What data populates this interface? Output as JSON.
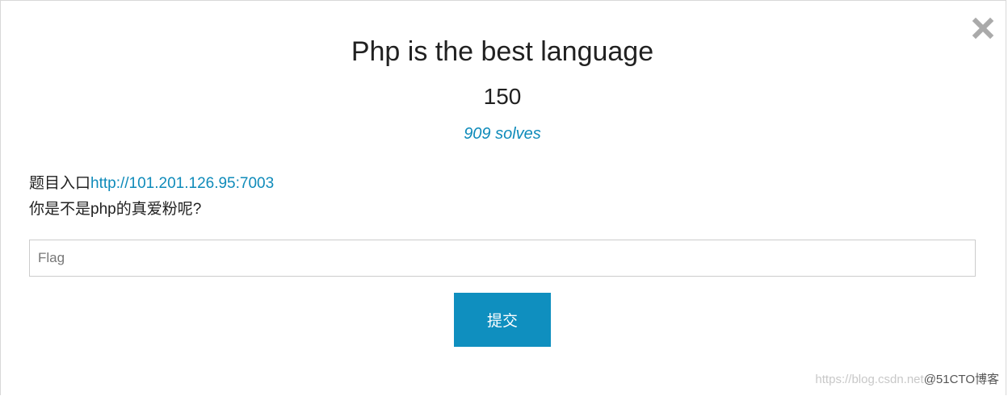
{
  "challenge": {
    "title": "Php is the best language",
    "points": "150",
    "solves": "909 solves",
    "description_prefix": "题目入口",
    "description_link": "http://101.201.126.95:7003",
    "description_line2": "你是不是php的真爱粉呢?"
  },
  "form": {
    "flag_placeholder": "Flag",
    "flag_value": "",
    "submit_label": "提交"
  },
  "close_icon": "close-x-icon",
  "watermark": {
    "url_text": "https://blog.csdn.net",
    "brand_text": "@51CTO博客"
  },
  "colors": {
    "accent": "#0f8fbf",
    "link": "#0f8bba",
    "close_icon": "#aaaaaa"
  }
}
